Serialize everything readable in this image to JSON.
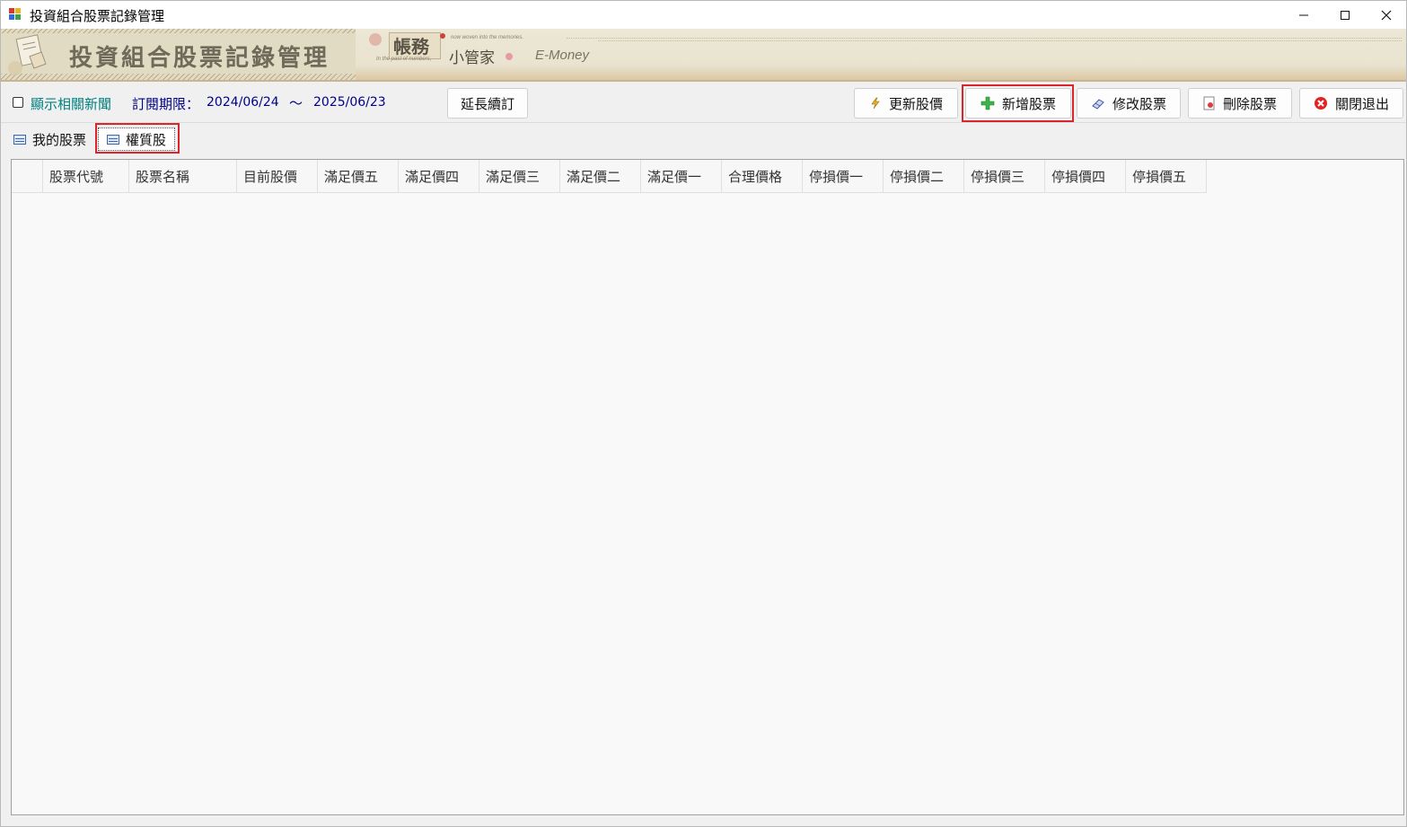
{
  "window": {
    "title": "投資組合股票記錄管理",
    "controls": {
      "minimize": "—",
      "maximize": "☐",
      "close": "✕"
    }
  },
  "banner": {
    "title": "投資組合股票記錄管理",
    "logo_main": "帳務",
    "logo_sub": "小管家",
    "logo_brand": "E-Money",
    "logo_tag_left": "In the past of numbers,",
    "logo_tag_right": "now woven into the memories."
  },
  "toolbar": {
    "show_news_label": "顯示相關新聞",
    "show_news_checked": false,
    "subscription_label": "訂閱期限：",
    "subscription_start": "2024/06/24",
    "subscription_tilde": "～",
    "subscription_end": "2025/06/23",
    "extend_button": "延長續訂",
    "update_price_button": "更新股價",
    "add_stock_button": "新增股票",
    "edit_stock_button": "修改股票",
    "delete_stock_button": "刪除股票",
    "exit_button": "關閉退出"
  },
  "tabs": [
    {
      "label": "我的股票",
      "active": false
    },
    {
      "label": "權質股",
      "active": true
    }
  ],
  "grid": {
    "columns": [
      "",
      "股票代號",
      "股票名稱",
      "目前股價",
      "滿足價五",
      "滿足價四",
      "滿足價三",
      "滿足價二",
      "滿足價一",
      "合理價格",
      "停損價一",
      "停損價二",
      "停損價三",
      "停損價四",
      "停損價五"
    ],
    "rows": []
  },
  "colors": {
    "highlight": "#d9252b",
    "subscription_text": "#00008b",
    "news_label": "#008080"
  }
}
